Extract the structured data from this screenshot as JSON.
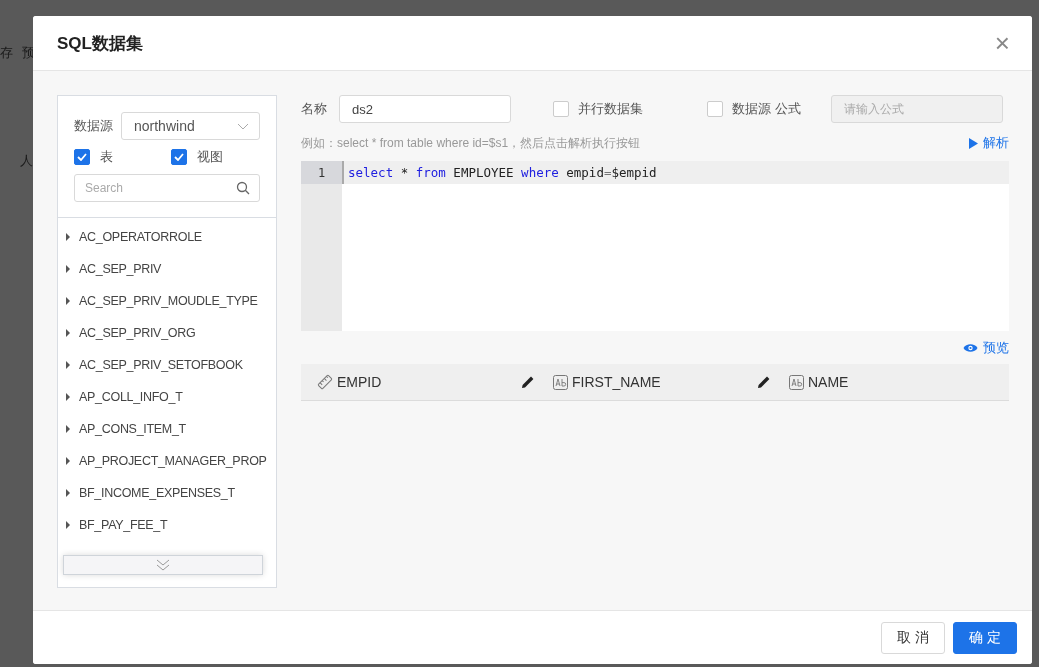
{
  "backdrop": {
    "fragments": [
      "存",
      "预",
      "人"
    ]
  },
  "dialog": {
    "title": "SQL数据集",
    "close": "×"
  },
  "left_panel": {
    "datasource_label": "数据源",
    "datasource_value": "northwind",
    "filters": [
      {
        "label": "表",
        "checked": true
      },
      {
        "label": "视图",
        "checked": true
      }
    ],
    "search": {
      "placeholder": "Search"
    },
    "tables": [
      {
        "name": "AC_OPERATORROLE"
      },
      {
        "name": "AC_SEP_PRIV"
      },
      {
        "name": "AC_SEP_PRIV_MOUDLE_TYPE"
      },
      {
        "name": "AC_SEP_PRIV_ORG"
      },
      {
        "name": "AC_SEP_PRIV_SETOFBOOK"
      },
      {
        "name": "AP_COLL_INFO_T"
      },
      {
        "name": "AP_CONS_ITEM_T"
      },
      {
        "name": "AP_PROJECT_MANAGER_PROP"
      },
      {
        "name": "BF_INCOME_EXPENSES_T"
      },
      {
        "name": "BF_PAY_FEE_T"
      }
    ]
  },
  "form": {
    "name_label": "名称",
    "name_value": "ds2",
    "options": [
      {
        "label": "并行数据集",
        "checked": false
      },
      {
        "label": "数据源 公式",
        "checked": false
      }
    ],
    "formula": {
      "placeholder": "请输入公式",
      "disabled": true
    },
    "hint": "例如：select * from table where id=$s1，然后点击解析执行按钮",
    "parse_button": "解析"
  },
  "editor": {
    "lines": [
      {
        "number": "1",
        "tokens": [
          {
            "kind": "keyword",
            "text": "select"
          },
          {
            "kind": "plain",
            "text": " * "
          },
          {
            "kind": "keyword",
            "text": "from"
          },
          {
            "kind": "plain",
            "text": " EMPLOYEE "
          },
          {
            "kind": "keyword",
            "text": "where"
          },
          {
            "kind": "plain",
            "text": " empid"
          },
          {
            "kind": "operator",
            "text": "="
          },
          {
            "kind": "plain",
            "text": "$empid"
          }
        ]
      }
    ]
  },
  "preview_button": "预览",
  "columns": [
    {
      "name": "EMPID",
      "kind": "number",
      "editable": true
    },
    {
      "name": "FIRST_NAME",
      "kind": "text",
      "editable": true
    },
    {
      "name": "NAME",
      "kind": "text",
      "editable": false
    }
  ],
  "footer": {
    "buttons": [
      {
        "label": "取 消",
        "kind": "secondary"
      },
      {
        "label": "确 定",
        "kind": "primary"
      }
    ]
  }
}
